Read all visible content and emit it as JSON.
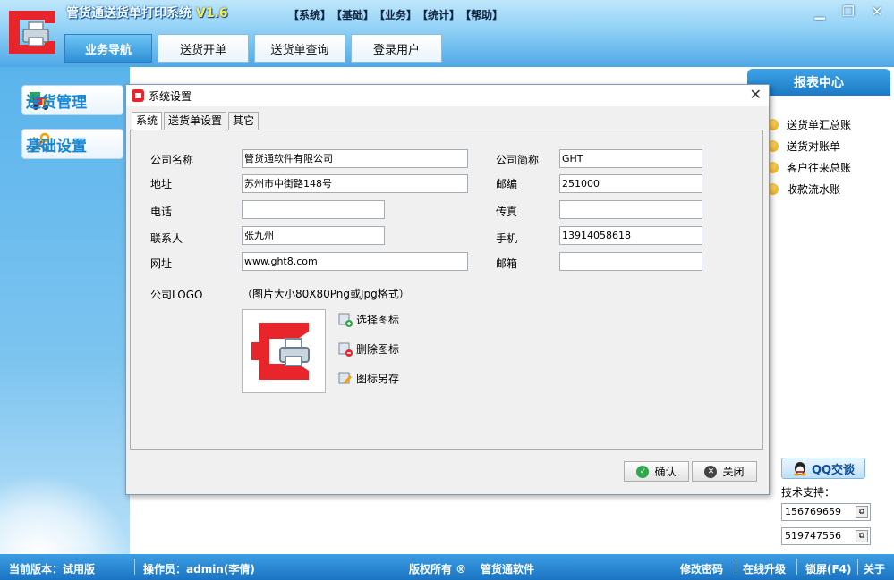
{
  "app": {
    "title": "管货通送货单打印系统",
    "version": "V1.6",
    "menus": [
      "【系统】",
      "【基础】",
      "【业务】",
      "【统计】",
      "【帮助】"
    ],
    "window_buttons": {
      "minimize": "▁",
      "restore": "❐",
      "close": "✕"
    }
  },
  "navtabs": [
    "业务导航",
    "送货开单",
    "送货单查询",
    "登录用户"
  ],
  "sidebar": {
    "items": [
      {
        "label": "送货管理",
        "icon": "delivery-truck-icon"
      },
      {
        "label": "基础设置",
        "icon": "tools-icon"
      }
    ]
  },
  "report_center": {
    "title": "报表中心",
    "items": [
      "送货单汇总账",
      "送货对账单",
      "客户往来总账",
      "收款流水账"
    ]
  },
  "support": {
    "qq_label": "QQ交谈",
    "label": "技术支持：",
    "phones": [
      "156769659",
      "519747556"
    ]
  },
  "status": {
    "version_label": "当前版本：试用版",
    "operator_label": "操作员：admin(李倩)",
    "copyright": "版权所有 ®",
    "company": "管货通软件",
    "change_password": "修改密码",
    "online_upgrade": "在线升级",
    "lock_screen": "锁屏(F4)",
    "about": "关于"
  },
  "dialog": {
    "title": "系统设置",
    "close": "✕",
    "tabs": [
      "系统",
      "送货单设置",
      "其它"
    ],
    "fields": {
      "company_name": {
        "label": "公司名称",
        "value": "管货通软件有限公司"
      },
      "company_short": {
        "label": "公司简称",
        "value": "GHT"
      },
      "address": {
        "label": "地址",
        "value": "苏州市中街路148号"
      },
      "postcode": {
        "label": "邮编",
        "value": "251000"
      },
      "phone": {
        "label": "电话",
        "value": ""
      },
      "fax": {
        "label": "传真",
        "value": ""
      },
      "contact": {
        "label": "联系人",
        "value": "张九州"
      },
      "mobile": {
        "label": "手机",
        "value": "13914058618"
      },
      "website": {
        "label": "网址",
        "value": "www.ght8.com"
      },
      "email": {
        "label": "邮箱",
        "value": ""
      }
    },
    "logo_label": "公司LOGO",
    "logo_hint": "（图片大小80X80Png或Jpg格式）",
    "logo_actions": [
      "选择图标",
      "删除图标",
      "图标另存"
    ],
    "ok": "确认",
    "cancel": "关闭"
  },
  "colors": {
    "accent_blue": "#1b79c5",
    "logo_red": "#e8252a",
    "ok_green": "#2ea84a"
  }
}
